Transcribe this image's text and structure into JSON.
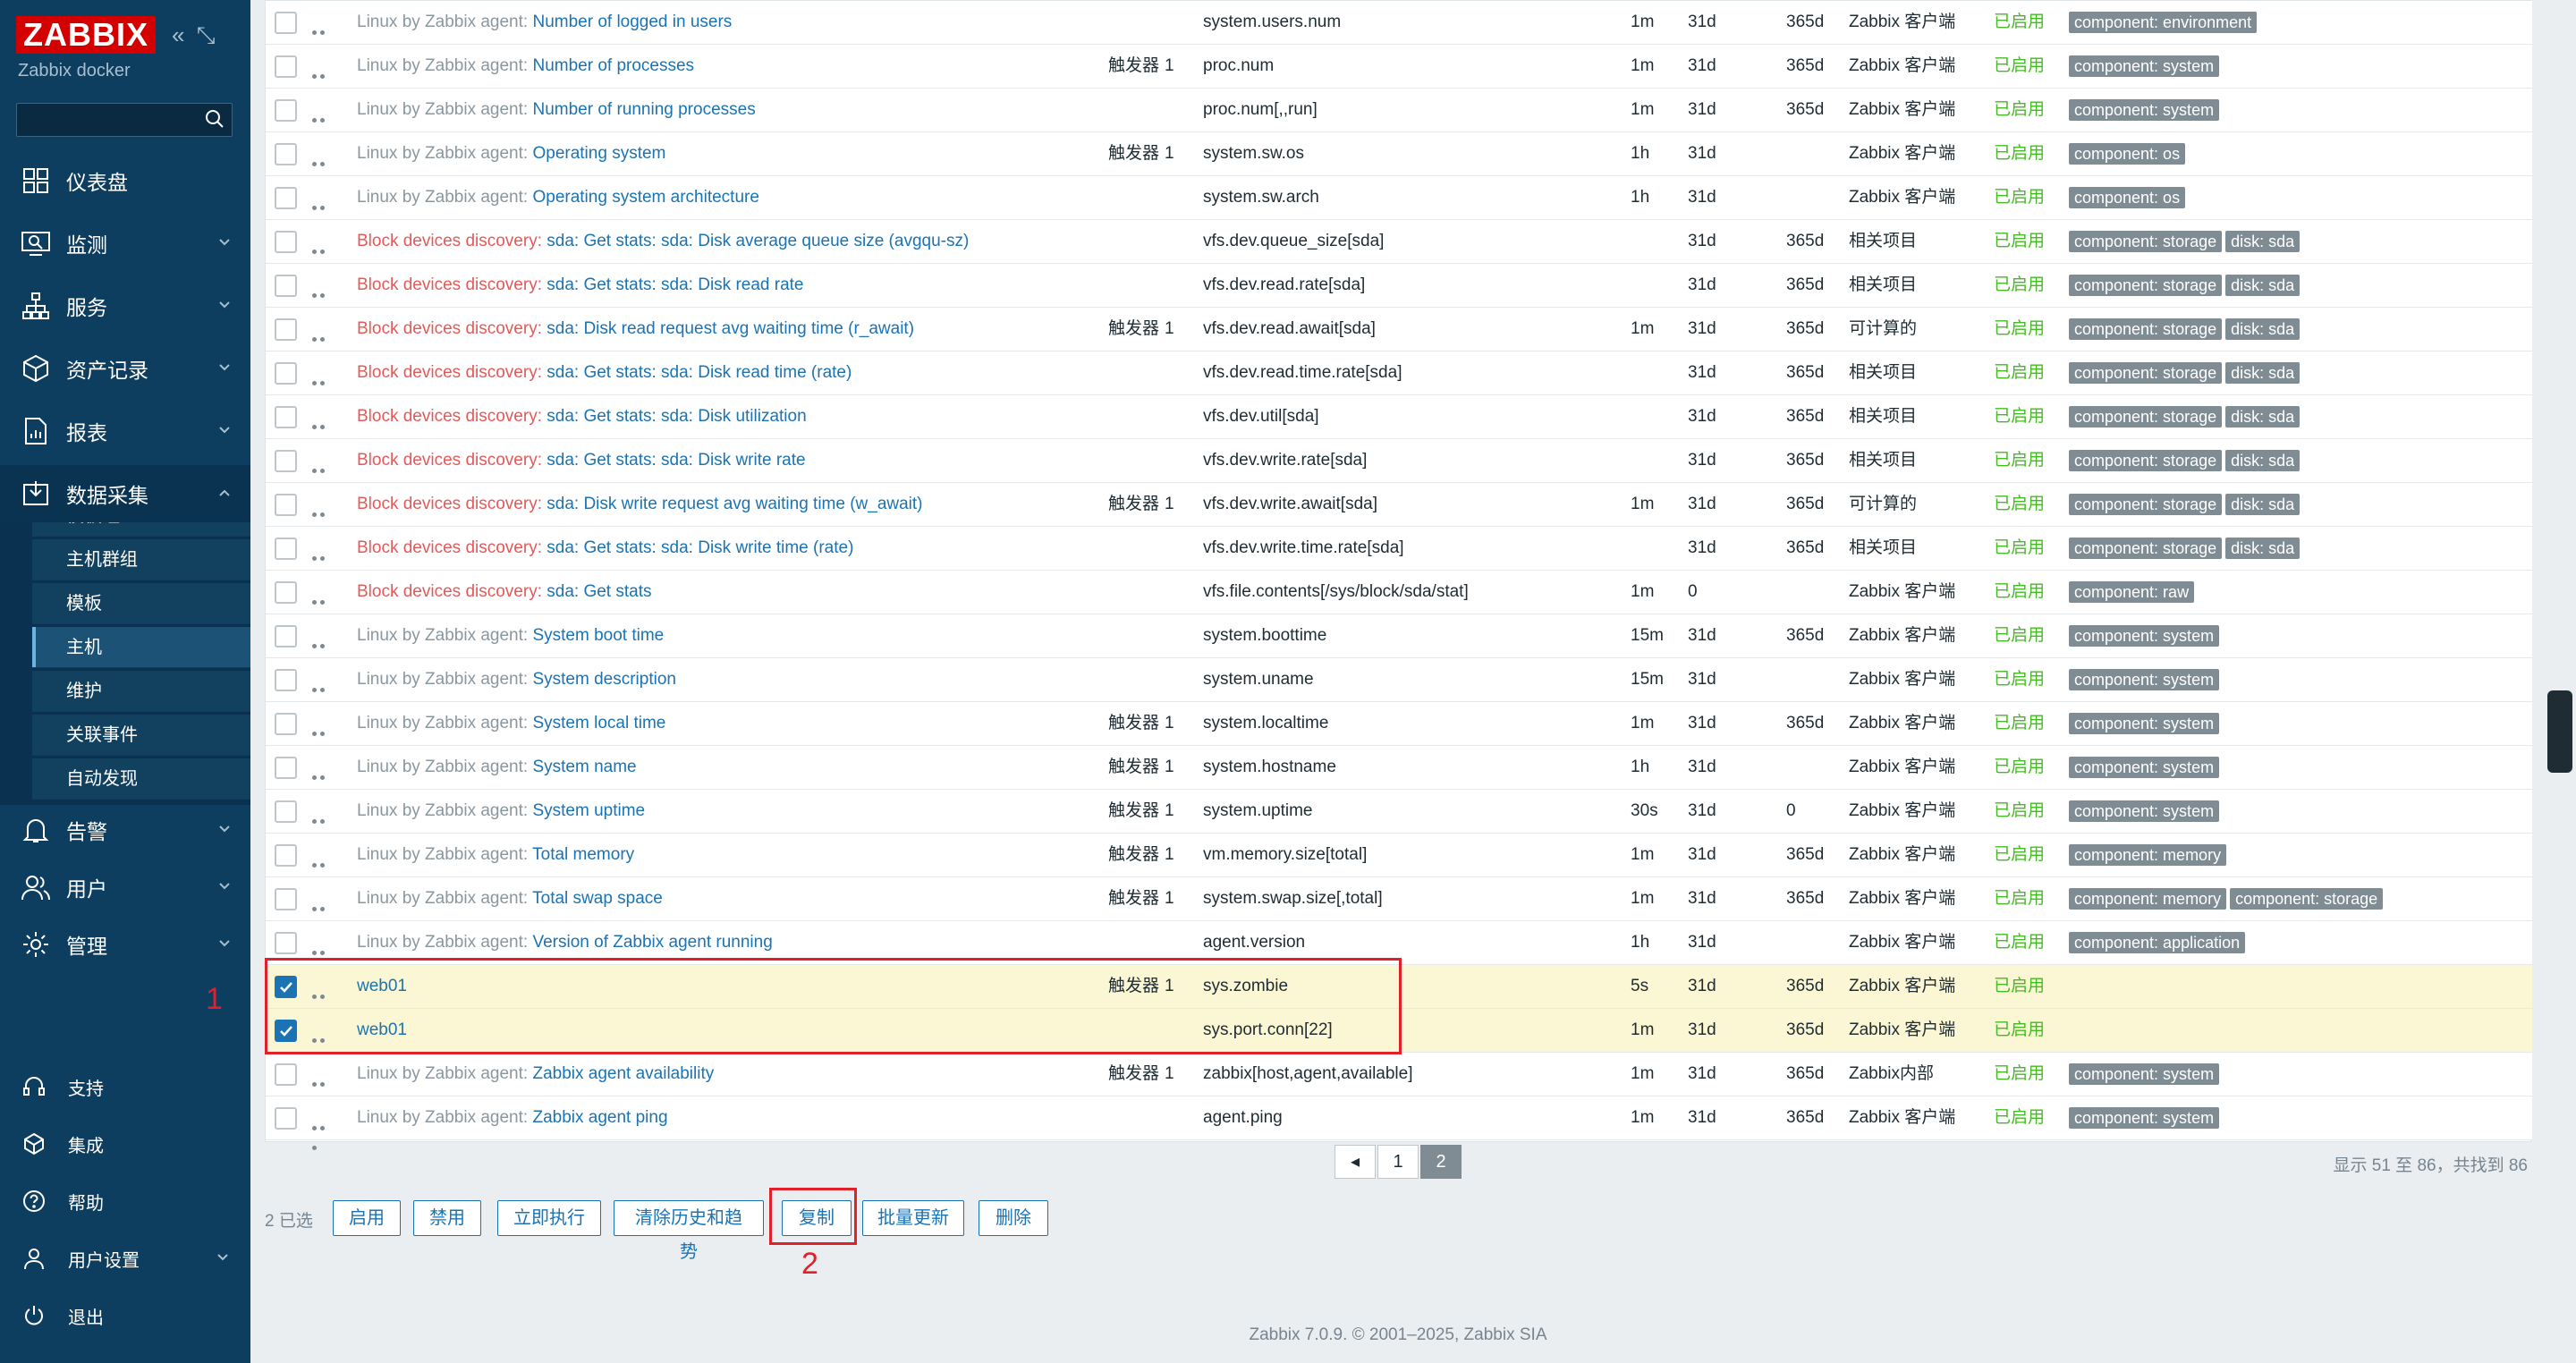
{
  "brand": {
    "logo": "ZABBIX",
    "subtitle": "Zabbix docker"
  },
  "menu": [
    {
      "label": "仪表盘",
      "icon": "dashboard-icon"
    },
    {
      "label": "监测",
      "icon": "monitoring-icon"
    },
    {
      "label": "服务",
      "icon": "services-icon"
    },
    {
      "label": "资产记录",
      "icon": "inventory-icon"
    },
    {
      "label": "报表",
      "icon": "reports-icon"
    },
    {
      "label": "数据采集",
      "icon": "data-collection-icon"
    }
  ],
  "submenu": [
    "模板组",
    "主机群组",
    "模板",
    "主机",
    "维护",
    "关联事件",
    "自动发现"
  ],
  "menu2": [
    {
      "label": "告警",
      "icon": "bell-icon"
    },
    {
      "label": "用户",
      "icon": "users-icon"
    },
    {
      "label": "管理",
      "icon": "gear-icon"
    }
  ],
  "bottom_menu": [
    {
      "label": "支持",
      "icon": "headset-icon"
    },
    {
      "label": "集成",
      "icon": "integrations-icon"
    },
    {
      "label": "帮助",
      "icon": "help-icon"
    },
    {
      "label": "用户设置",
      "icon": "user-settings-icon"
    },
    {
      "label": "退出",
      "icon": "power-icon"
    }
  ],
  "annotations": {
    "one": "1",
    "two": "2"
  },
  "rows": [
    {
      "prefix": "Linux by Zabbix agent: ",
      "name": "Number of logged in users",
      "trig": "",
      "key": "system.users.num",
      "interval": "1m",
      "history": "31d",
      "trends": "365d",
      "type": "Zabbix 客户端",
      "status": "已启用",
      "tags": [
        "component: environment"
      ]
    },
    {
      "prefix": "Linux by Zabbix agent: ",
      "name": "Number of processes",
      "trig": "1",
      "key": "proc.num",
      "interval": "1m",
      "history": "31d",
      "trends": "365d",
      "type": "Zabbix 客户端",
      "status": "已启用",
      "tags": [
        "component: system"
      ]
    },
    {
      "prefix": "Linux by Zabbix agent: ",
      "name": "Number of running processes",
      "trig": "",
      "key": "proc.num[,,run]",
      "interval": "1m",
      "history": "31d",
      "trends": "365d",
      "type": "Zabbix 客户端",
      "status": "已启用",
      "tags": [
        "component: system"
      ]
    },
    {
      "prefix": "Linux by Zabbix agent: ",
      "name": "Operating system",
      "trig": "1",
      "key": "system.sw.os",
      "interval": "1h",
      "history": "31d",
      "trends": "",
      "type": "Zabbix 客户端",
      "status": "已启用",
      "tags": [
        "component: os"
      ]
    },
    {
      "prefix": "Linux by Zabbix agent: ",
      "name": "Operating system architecture",
      "trig": "",
      "key": "system.sw.arch",
      "interval": "1h",
      "history": "31d",
      "trends": "",
      "type": "Zabbix 客户端",
      "status": "已启用",
      "tags": [
        "component: os"
      ]
    },
    {
      "prefix": "Block devices discovery: ",
      "red": true,
      "name": "sda: Get stats: sda: Disk average queue size (avgqu-sz)",
      "trig": "",
      "key": "vfs.dev.queue_size[sda]",
      "interval": "",
      "history": "31d",
      "trends": "365d",
      "type": "相关项目",
      "status": "已启用",
      "tags": [
        "component: storage",
        "disk: sda"
      ]
    },
    {
      "prefix": "Block devices discovery: ",
      "red": true,
      "name": "sda: Get stats: sda: Disk read rate",
      "trig": "",
      "key": "vfs.dev.read.rate[sda]",
      "interval": "",
      "history": "31d",
      "trends": "365d",
      "type": "相关项目",
      "status": "已启用",
      "tags": [
        "component: storage",
        "disk: sda"
      ]
    },
    {
      "prefix": "Block devices discovery: ",
      "red": true,
      "name": "sda: Disk read request avg waiting time (r_await)",
      "trig": "1",
      "key": "vfs.dev.read.await[sda]",
      "interval": "1m",
      "history": "31d",
      "trends": "365d",
      "type": "可计算的",
      "status": "已启用",
      "tags": [
        "component: storage",
        "disk: sda"
      ]
    },
    {
      "prefix": "Block devices discovery: ",
      "red": true,
      "name": "sda: Get stats: sda: Disk read time (rate)",
      "trig": "",
      "key": "vfs.dev.read.time.rate[sda]",
      "interval": "",
      "history": "31d",
      "trends": "365d",
      "type": "相关项目",
      "status": "已启用",
      "tags": [
        "component: storage",
        "disk: sda"
      ]
    },
    {
      "prefix": "Block devices discovery: ",
      "red": true,
      "name": "sda: Get stats: sda: Disk utilization",
      "trig": "",
      "key": "vfs.dev.util[sda]",
      "interval": "",
      "history": "31d",
      "trends": "365d",
      "type": "相关项目",
      "status": "已启用",
      "tags": [
        "component: storage",
        "disk: sda"
      ]
    },
    {
      "prefix": "Block devices discovery: ",
      "red": true,
      "name": "sda: Get stats: sda: Disk write rate",
      "trig": "",
      "key": "vfs.dev.write.rate[sda]",
      "interval": "",
      "history": "31d",
      "trends": "365d",
      "type": "相关项目",
      "status": "已启用",
      "tags": [
        "component: storage",
        "disk: sda"
      ]
    },
    {
      "prefix": "Block devices discovery: ",
      "red": true,
      "name": "sda: Disk write request avg waiting time (w_await)",
      "trig": "1",
      "key": "vfs.dev.write.await[sda]",
      "interval": "1m",
      "history": "31d",
      "trends": "365d",
      "type": "可计算的",
      "status": "已启用",
      "tags": [
        "component: storage",
        "disk: sda"
      ]
    },
    {
      "prefix": "Block devices discovery: ",
      "red": true,
      "name": "sda: Get stats: sda: Disk write time (rate)",
      "trig": "",
      "key": "vfs.dev.write.time.rate[sda]",
      "interval": "",
      "history": "31d",
      "trends": "365d",
      "type": "相关项目",
      "status": "已启用",
      "tags": [
        "component: storage",
        "disk: sda"
      ]
    },
    {
      "prefix": "Block devices discovery: ",
      "red": true,
      "name": "sda: Get stats",
      "trig": "",
      "key": "vfs.file.contents[/sys/block/sda/stat]",
      "interval": "1m",
      "history": "0",
      "trends": "",
      "type": "Zabbix 客户端",
      "status": "已启用",
      "tags": [
        "component: raw"
      ]
    },
    {
      "prefix": "Linux by Zabbix agent: ",
      "name": "System boot time",
      "trig": "",
      "key": "system.boottime",
      "interval": "15m",
      "history": "31d",
      "trends": "365d",
      "type": "Zabbix 客户端",
      "status": "已启用",
      "tags": [
        "component: system"
      ]
    },
    {
      "prefix": "Linux by Zabbix agent: ",
      "name": "System description",
      "trig": "",
      "key": "system.uname",
      "interval": "15m",
      "history": "31d",
      "trends": "",
      "type": "Zabbix 客户端",
      "status": "已启用",
      "tags": [
        "component: system"
      ]
    },
    {
      "prefix": "Linux by Zabbix agent: ",
      "name": "System local time",
      "trig": "1",
      "key": "system.localtime",
      "interval": "1m",
      "history": "31d",
      "trends": "365d",
      "type": "Zabbix 客户端",
      "status": "已启用",
      "tags": [
        "component: system"
      ]
    },
    {
      "prefix": "Linux by Zabbix agent: ",
      "name": "System name",
      "trig": "1",
      "key": "system.hostname",
      "interval": "1h",
      "history": "31d",
      "trends": "",
      "type": "Zabbix 客户端",
      "status": "已启用",
      "tags": [
        "component: system"
      ]
    },
    {
      "prefix": "Linux by Zabbix agent: ",
      "name": "System uptime",
      "trig": "1",
      "key": "system.uptime",
      "interval": "30s",
      "history": "31d",
      "trends": "0",
      "type": "Zabbix 客户端",
      "status": "已启用",
      "tags": [
        "component: system"
      ]
    },
    {
      "prefix": "Linux by Zabbix agent: ",
      "name": "Total memory",
      "trig": "1",
      "key": "vm.memory.size[total]",
      "interval": "1m",
      "history": "31d",
      "trends": "365d",
      "type": "Zabbix 客户端",
      "status": "已启用",
      "tags": [
        "component: memory"
      ]
    },
    {
      "prefix": "Linux by Zabbix agent: ",
      "name": "Total swap space",
      "trig": "1",
      "key": "system.swap.size[,total]",
      "interval": "1m",
      "history": "31d",
      "trends": "365d",
      "type": "Zabbix 客户端",
      "status": "已启用",
      "tags": [
        "component: memory",
        "component: storage"
      ]
    },
    {
      "prefix": "Linux by Zabbix agent: ",
      "name": "Version of Zabbix agent running",
      "trig": "",
      "key": "agent.version",
      "interval": "1h",
      "history": "31d",
      "trends": "",
      "type": "Zabbix 客户端",
      "status": "已启用",
      "tags": [
        "component: application"
      ]
    },
    {
      "prefix": "",
      "name": "web01",
      "checked": true,
      "trig": "1",
      "key": "sys.zombie",
      "interval": "5s",
      "history": "31d",
      "trends": "365d",
      "type": "Zabbix 客户端",
      "status": "已启用",
      "tags": []
    },
    {
      "prefix": "",
      "name": "web01",
      "checked": true,
      "trig": "",
      "key": "sys.port.conn[22]",
      "interval": "1m",
      "history": "31d",
      "trends": "365d",
      "type": "Zabbix 客户端",
      "status": "已启用",
      "tags": []
    },
    {
      "prefix": "Linux by Zabbix agent: ",
      "name": "Zabbix agent availability",
      "trig": "1",
      "key": "zabbix[host,agent,available]",
      "interval": "1m",
      "history": "31d",
      "trends": "365d",
      "type": "Zabbix内部",
      "status": "已启用",
      "tags": [
        "component: system"
      ]
    },
    {
      "prefix": "Linux by Zabbix agent: ",
      "name": "Zabbix agent ping",
      "trig": "",
      "key": "agent.ping",
      "interval": "1m",
      "history": "31d",
      "trends": "365d",
      "type": "Zabbix 客户端",
      "status": "已启用",
      "tags": [
        "component: system"
      ]
    }
  ],
  "trigger_label": "触发器",
  "pager": {
    "prev": "◂",
    "pages": [
      "1",
      "2"
    ],
    "current": "2",
    "info": "显示 51 至 86，共找到 86"
  },
  "actions": {
    "selected": "2 已选",
    "enable": "启用",
    "disable": "禁用",
    "execute_now": "立即执行",
    "clear_history": "清除历史和趋势",
    "copy": "复制",
    "mass_update": "批量更新",
    "delete": "删除"
  },
  "footer": "Zabbix 7.0.9. © 2001–2025, Zabbix SIA",
  "colors": {
    "sidebar": "#0e3e5f",
    "link": "#1b73b3",
    "status": "#44bb22",
    "discovery_prefix": "#e45959",
    "selected_row": "#fbf6d3",
    "annotation": "#e0202a"
  }
}
